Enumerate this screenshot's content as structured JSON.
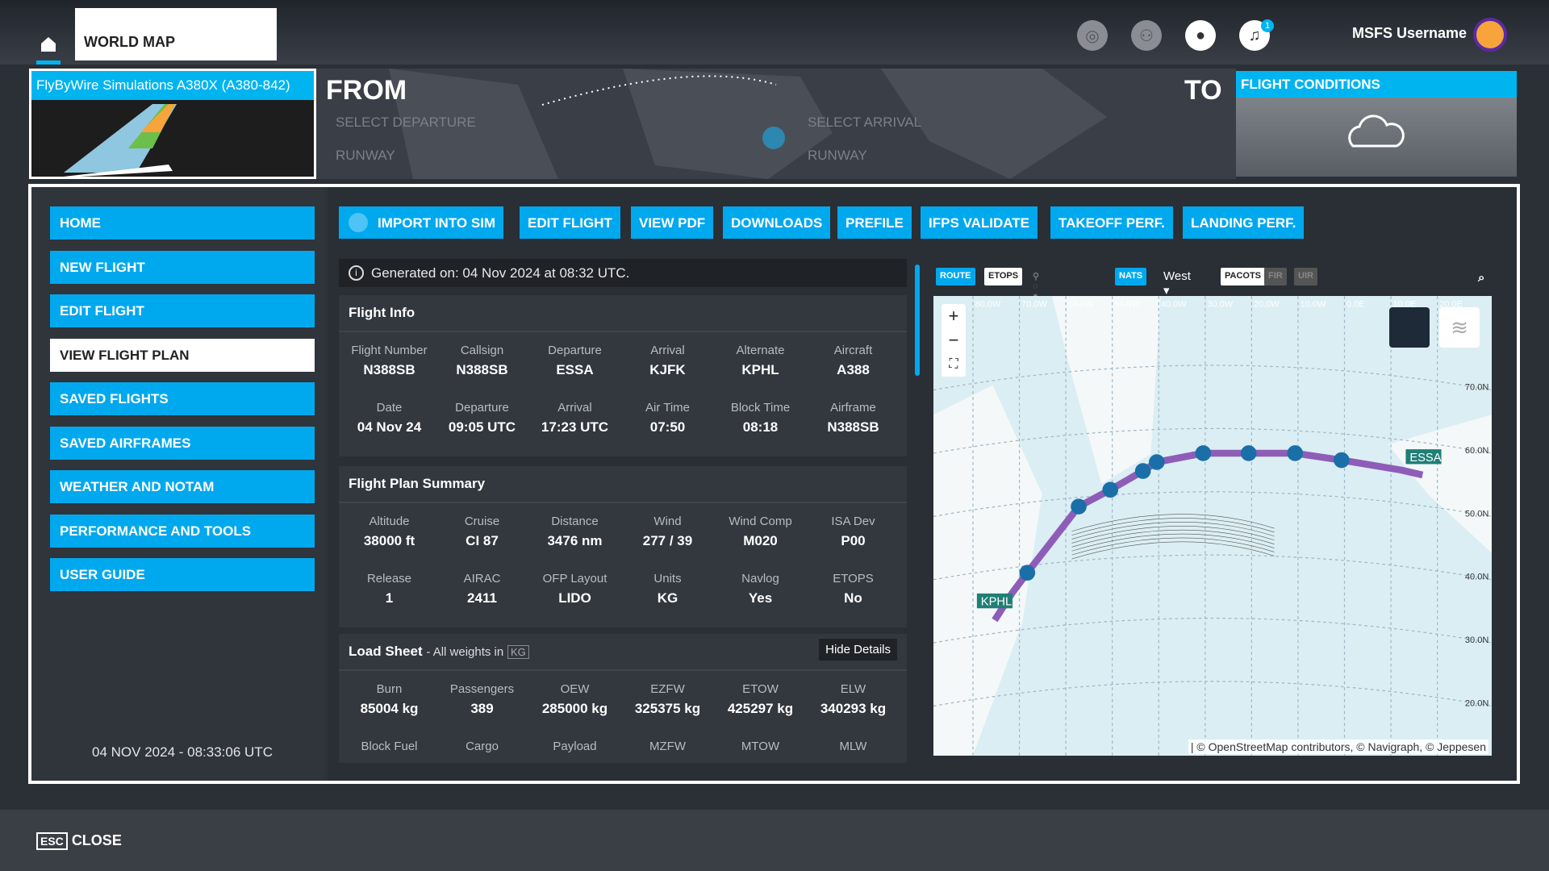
{
  "topbar": {
    "tab": "WORLD MAP",
    "username": "MSFS Username",
    "notifications": "1",
    "icons": [
      "home-icon",
      "marketplace-icon",
      "friends-icon",
      "profile-icon",
      "bell-icon"
    ]
  },
  "aircraft": {
    "title": "FlyByWire Simulations A380X (A380-842)"
  },
  "route": {
    "from": "FROM",
    "to": "TO",
    "select_departure": "SELECT DEPARTURE",
    "select_arrival": "SELECT ARRIVAL",
    "runway_dep": "RUNWAY",
    "runway_arr": "RUNWAY"
  },
  "conditions": {
    "title": "FLIGHT CONDITIONS"
  },
  "sidebar": {
    "items": [
      "HOME",
      "NEW FLIGHT",
      "EDIT FLIGHT",
      "VIEW FLIGHT PLAN",
      "SAVED FLIGHTS",
      "SAVED AIRFRAMES",
      "WEATHER AND NOTAM",
      "PERFORMANCE AND TOOLS",
      "USER GUIDE"
    ],
    "active": 3,
    "datetime": "04 NOV 2024 - 08:33:06 UTC"
  },
  "toolbar": [
    "IMPORT INTO SIM",
    "EDIT FLIGHT",
    "VIEW PDF",
    "DOWNLOADS",
    "PREFILE",
    "IFPS VALIDATE",
    "TAKEOFF PERF.",
    "LANDING PERF."
  ],
  "generated": "Generated on: 04 Nov 2024 at 08:32 UTC.",
  "flight_info": {
    "title": "Flight Info",
    "rows": [
      [
        [
          "Flight Number",
          "N388SB"
        ],
        [
          "Callsign",
          "N388SB"
        ],
        [
          "Departure",
          "ESSA"
        ],
        [
          "Arrival",
          "KJFK"
        ],
        [
          "Alternate",
          "KPHL"
        ],
        [
          "Aircraft",
          "A388"
        ]
      ],
      [
        [
          "Date",
          "04 Nov 24"
        ],
        [
          "Departure",
          "09:05 UTC"
        ],
        [
          "Arrival",
          "17:23 UTC"
        ],
        [
          "Air Time",
          "07:50"
        ],
        [
          "Block Time",
          "08:18"
        ],
        [
          "Airframe",
          "N388SB"
        ]
      ]
    ]
  },
  "summary": {
    "title": "Flight Plan Summary",
    "rows": [
      [
        [
          "Altitude",
          "38000 ft"
        ],
        [
          "Cruise",
          "CI 87"
        ],
        [
          "Distance",
          "3476 nm"
        ],
        [
          "Wind",
          "277 / 39"
        ],
        [
          "Wind Comp",
          "M020"
        ],
        [
          "ISA Dev",
          "P00"
        ]
      ],
      [
        [
          "Release",
          "1"
        ],
        [
          "AIRAC",
          "2411"
        ],
        [
          "OFP Layout",
          "LIDO"
        ],
        [
          "Units",
          "KG"
        ],
        [
          "Navlog",
          "Yes"
        ],
        [
          "ETOPS",
          "No"
        ]
      ]
    ]
  },
  "load": {
    "title": "Load Sheet",
    "subtitle": "- All weights in",
    "unit": "KG",
    "hide": "Hide Details",
    "rows": [
      [
        [
          "Burn",
          "85004 kg"
        ],
        [
          "Passengers",
          "389"
        ],
        [
          "OEW",
          "285000 kg"
        ],
        [
          "EZFW",
          "325375 kg"
        ],
        [
          "ETOW",
          "425297 kg"
        ],
        [
          "ELW",
          "340293 kg"
        ]
      ],
      [
        [
          "Block Fuel",
          ""
        ],
        [
          "Cargo",
          ""
        ],
        [
          "Payload",
          ""
        ],
        [
          "MZFW",
          ""
        ],
        [
          "MTOW",
          ""
        ],
        [
          "MLW",
          ""
        ]
      ]
    ]
  },
  "map": {
    "chips": [
      "ROUTE",
      "ETOPS",
      "NATS",
      "West",
      "PACOTS",
      "FIR",
      "UIR"
    ],
    "lon_labels": [
      "80.0W",
      "70.0W",
      "60.0W",
      "50.0W",
      "40.0W",
      "30.0W",
      "20.0W",
      "10.0W",
      "0.0E",
      "10.0E",
      "20.0E"
    ],
    "lat_labels": [
      "70.0N",
      "60.0N",
      "50.0N",
      "40.0N",
      "30.0N",
      "20.0N"
    ],
    "origin": "ESSA",
    "destination": "KPHL",
    "attribution": "| © OpenStreetMap contributors, © Navigraph, © Jeppesen",
    "route_color": "#8e5db8"
  },
  "footer": {
    "key": "ESC",
    "close": "CLOSE"
  }
}
